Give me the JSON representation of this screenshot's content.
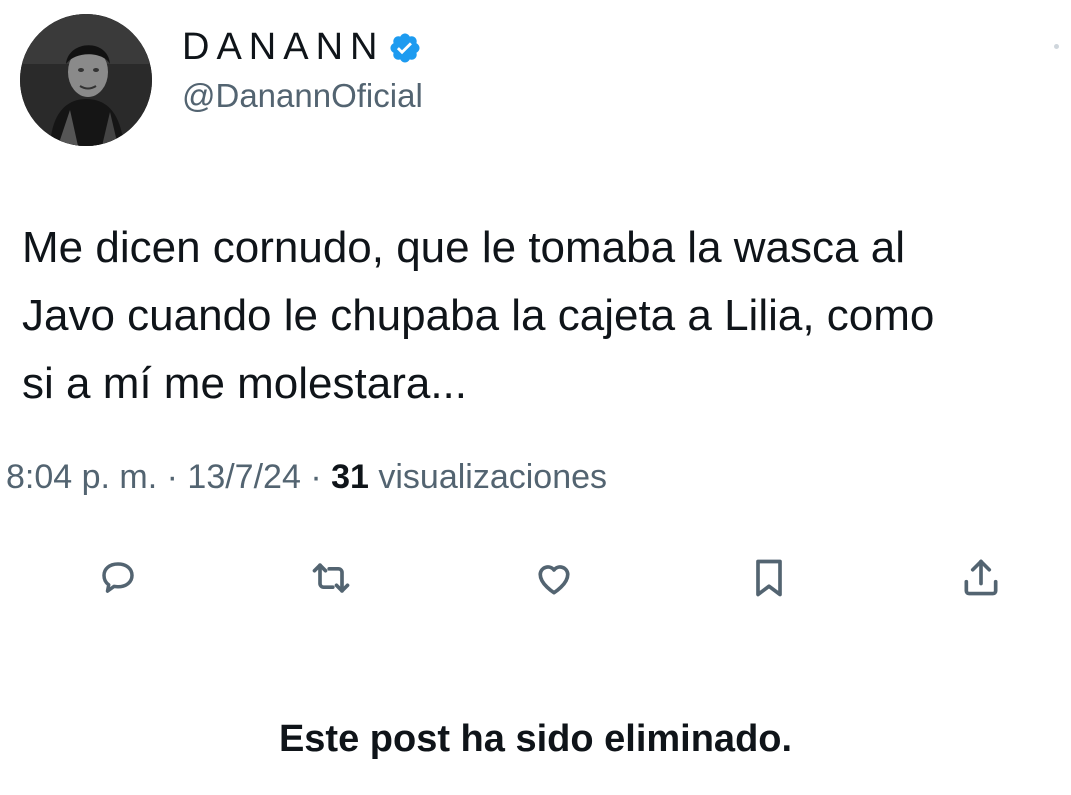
{
  "author": {
    "display_name": "DANANN",
    "handle": "@DanannOficial",
    "verified": true,
    "avatar_icon": "profile-photo"
  },
  "tweet": {
    "text": "Me dicen cornudo, que le tomaba la wasca al\nJavo cuando le chupaba la cajeta a Lilia, como\nsi a mí me molestara..."
  },
  "meta": {
    "time": "8:04 p. m.",
    "separator": " · ",
    "date": "13/7/24",
    "views_count": "31",
    "views_label": " visualizaciones"
  },
  "actions": [
    {
      "name": "reply",
      "icon": "speech-bubble-icon"
    },
    {
      "name": "repost",
      "icon": "repost-arrows-icon"
    },
    {
      "name": "like",
      "icon": "heart-icon"
    },
    {
      "name": "bookmark",
      "icon": "bookmark-icon"
    },
    {
      "name": "share",
      "icon": "share-upload-icon"
    }
  ],
  "notice": {
    "deleted_text": "Este post ha sido eliminado."
  },
  "colors": {
    "text": "#0f1419",
    "secondary": "#536471",
    "verified": "#1d9bf0",
    "background": "#ffffff"
  }
}
